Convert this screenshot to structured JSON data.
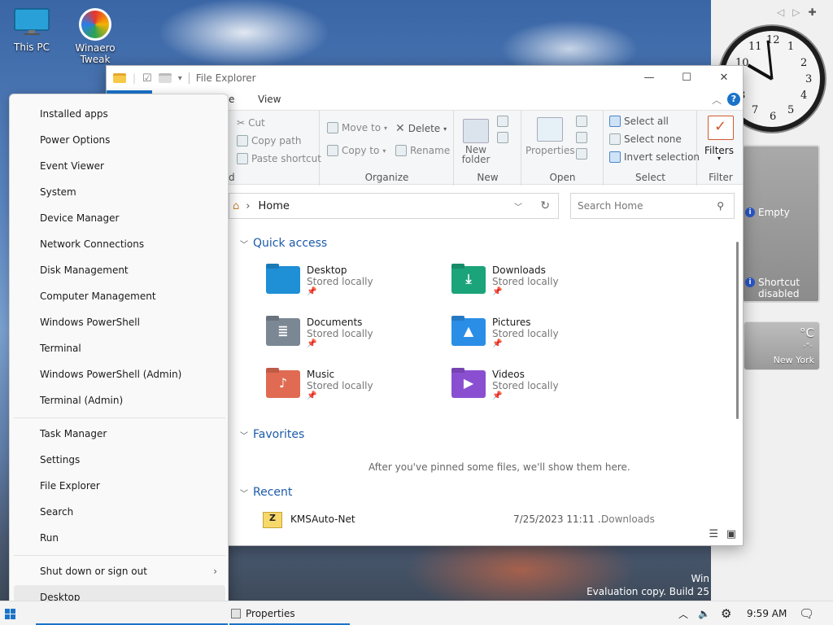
{
  "desktop": {
    "icons": [
      {
        "label": "This PC",
        "icon": "monitor-icon"
      },
      {
        "label": "Winaero Tweak",
        "icon": "winaero-icon"
      }
    ],
    "watermark": {
      "line1": "Win",
      "line2": "Evaluation copy. Build 25"
    }
  },
  "gadgets": {
    "clock": {
      "time": "9:59"
    },
    "info": {
      "empty_label": "Empty",
      "shortcut_label": "Shortcut disabled"
    },
    "weather": {
      "unit": "°C",
      "value": "-\"-",
      "city": "New York"
    }
  },
  "explorer": {
    "title": "File Explorer",
    "tabs": [
      "e",
      "View"
    ],
    "ribbon": {
      "clipboard": {
        "cut": "Cut",
        "copy_path": "Copy path",
        "paste_shortcut": "Paste shortcut",
        "label": "d"
      },
      "organize": {
        "move_to": "Move to",
        "copy_to": "Copy to",
        "delete": "Delete",
        "rename": "Rename",
        "label": "Organize"
      },
      "new": {
        "new_folder": "New folder",
        "label": "New"
      },
      "open": {
        "properties": "Properties",
        "label": "Open"
      },
      "select": {
        "select_all": "Select all",
        "select_none": "Select none",
        "invert": "Invert selection",
        "label": "Select"
      },
      "filter": {
        "filters": "Filters",
        "label": "Filter"
      }
    },
    "address": {
      "path": "Home"
    },
    "search": {
      "placeholder": "Search Home"
    },
    "quick_access": {
      "heading": "Quick access",
      "items": [
        {
          "name": "Desktop",
          "sub": "Stored locally",
          "color": "#1f8fd6",
          "glyph": ""
        },
        {
          "name": "Downloads",
          "sub": "Stored locally",
          "color": "#1ba37a",
          "glyph": "⤓"
        },
        {
          "name": "Documents",
          "sub": "Stored locally",
          "color": "#7c8794",
          "glyph": "≣"
        },
        {
          "name": "Pictures",
          "sub": "Stored locally",
          "color": "#2b8ee6",
          "glyph": "▲"
        },
        {
          "name": "Music",
          "sub": "Stored locally",
          "color": "#e06b52",
          "glyph": "♪"
        },
        {
          "name": "Videos",
          "sub": "Stored locally",
          "color": "#8a4fd1",
          "glyph": "▶"
        }
      ]
    },
    "favorites": {
      "heading": "Favorites",
      "empty_text": "After you've pinned some files, we'll show them here."
    },
    "recent": {
      "heading": "Recent",
      "items": [
        {
          "name": "KMSAuto-Net",
          "date": "7/25/2023 11:11 ...",
          "location": "Downloads"
        }
      ]
    }
  },
  "context_menu": {
    "items": [
      "Installed apps",
      "Power Options",
      "Event Viewer",
      "System",
      "Device Manager",
      "Network Connections",
      "Disk Management",
      "Computer Management",
      "Windows PowerShell",
      "Terminal",
      "Windows PowerShell (Admin)",
      "Terminal (Admin)"
    ],
    "items2": [
      "Task Manager",
      "Settings",
      "File Explorer",
      "Search",
      "Run"
    ],
    "shutdown": "Shut down or sign out",
    "desktop": "Desktop"
  },
  "taskbar": {
    "active_window": "Properties",
    "time": "9:59 AM"
  }
}
